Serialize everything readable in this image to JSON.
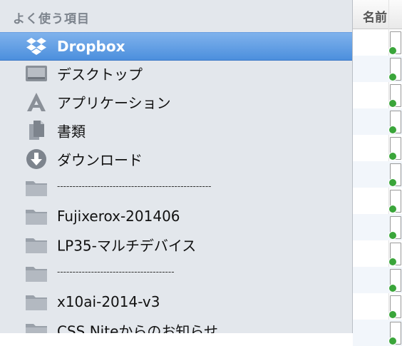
{
  "sidebar": {
    "section_title": "よく使う項目",
    "items": [
      {
        "label": "Dropbox",
        "icon": "dropbox-icon",
        "selected": true
      },
      {
        "label": "デスクトップ",
        "icon": "desktop-icon"
      },
      {
        "label": "アプリケーション",
        "icon": "applications-icon"
      },
      {
        "label": "書類",
        "icon": "documents-icon"
      },
      {
        "label": "ダウンロード",
        "icon": "downloads-icon"
      },
      {
        "label": "--------------------------------------------------",
        "icon": "folder-icon"
      },
      {
        "label": "Fujixerox-201406",
        "icon": "folder-icon"
      },
      {
        "label": "LP35-マルチデバイス",
        "icon": "folder-icon"
      },
      {
        "label": "--------------------------------------",
        "icon": "folder-icon"
      },
      {
        "label": "x10ai-2014-v3",
        "icon": "folder-icon"
      },
      {
        "label": "CSS Niteからのお知らせ",
        "icon": "folder-icon"
      }
    ]
  },
  "file_list": {
    "column_header": "名前",
    "rows": [
      {
        "icon": "file-icon"
      },
      {
        "icon": "file-icon"
      },
      {
        "icon": "file-icon"
      },
      {
        "icon": "file-icon"
      },
      {
        "icon": "file-icon"
      },
      {
        "icon": "file-icon"
      },
      {
        "icon": "file-icon"
      },
      {
        "icon": "file-icon"
      },
      {
        "icon": "file-icon"
      },
      {
        "icon": "file-icon"
      },
      {
        "icon": "file-icon"
      },
      {
        "icon": "file-icon"
      }
    ]
  },
  "colors": {
    "selection": "#4c8fdd",
    "sidebar_bg": "#e3e7ec",
    "folder": "#9aa1aa",
    "status_green": "#3aa53a"
  }
}
